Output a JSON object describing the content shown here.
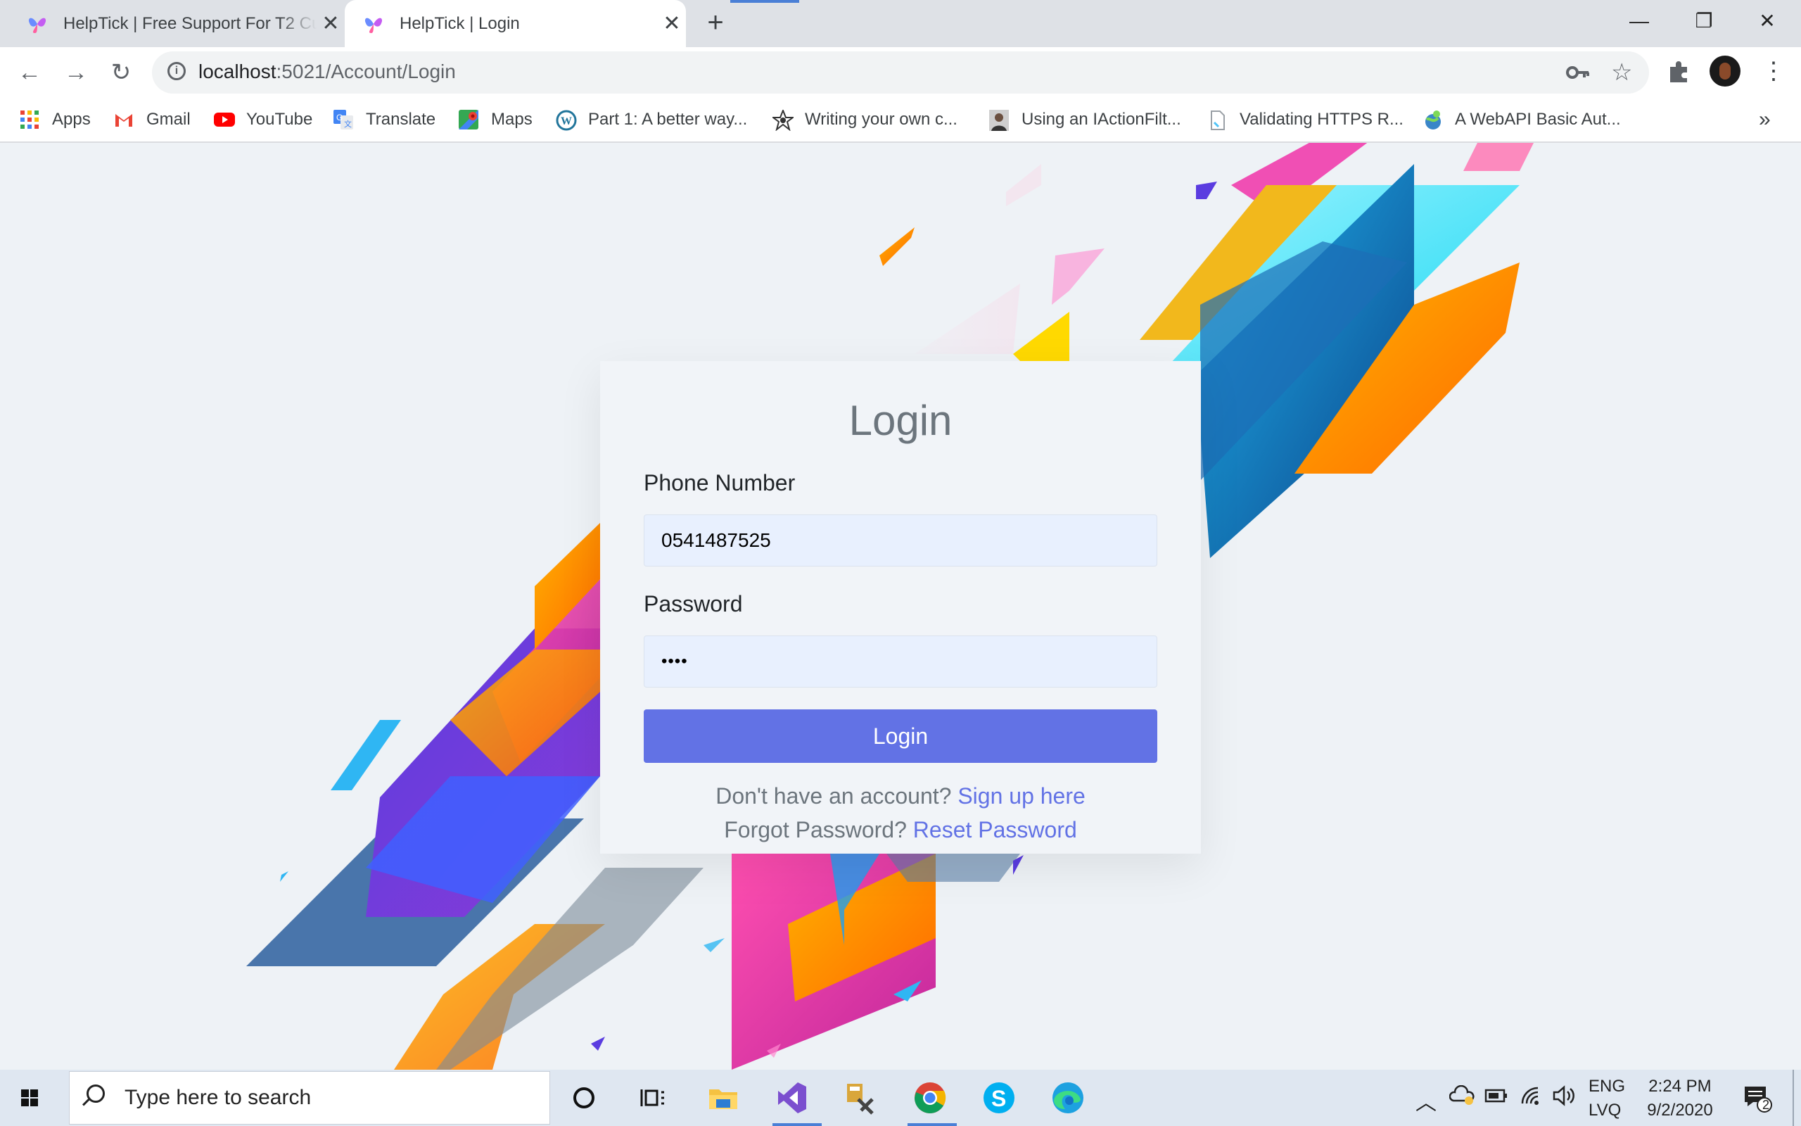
{
  "browser": {
    "tabs": [
      {
        "title": "HelpTick | Free Support For T2 Cu",
        "active": false
      },
      {
        "title": "HelpTick | Login",
        "active": true
      }
    ],
    "url_host": "localhost",
    "url_path": ":5021/Account/Login",
    "bookmarks": [
      {
        "label": "Apps",
        "icon": "apps-grid-icon"
      },
      {
        "label": "Gmail",
        "icon": "gmail-icon"
      },
      {
        "label": "YouTube",
        "icon": "youtube-icon"
      },
      {
        "label": "Translate",
        "icon": "translate-icon"
      },
      {
        "label": "Maps",
        "icon": "maps-icon"
      },
      {
        "label": "Part 1: A better way...",
        "icon": "wordpress-icon"
      },
      {
        "label": "Writing your own c...",
        "icon": "star-logo-icon"
      },
      {
        "label": "Using an IActionFilt...",
        "icon": "profile-photo-icon"
      },
      {
        "label": "Validating HTTPS R...",
        "icon": "page-icon"
      },
      {
        "label": "A WebAPI Basic Aut...",
        "icon": "globe-icon"
      }
    ],
    "overflow": "»"
  },
  "login": {
    "heading": "Login",
    "phone_label": "Phone Number",
    "phone_value": "0541487525",
    "password_label": "Password",
    "password_value": "••••",
    "button": "Login",
    "signup_prompt": "Don't have an account?",
    "signup_link": "Sign up here",
    "forgot_prompt": "Forgot Password?",
    "reset_link": "Reset Password"
  },
  "taskbar": {
    "search_placeholder": "Type here to search",
    "lang_top": "ENG",
    "lang_bottom": "LVQ",
    "time": "2:24 PM",
    "date": "9/2/2020",
    "notification_count": "2"
  },
  "colors": {
    "accent": "#6272e5",
    "input_bg": "#e8f0fe",
    "card_bg": "#f1f4f8"
  }
}
